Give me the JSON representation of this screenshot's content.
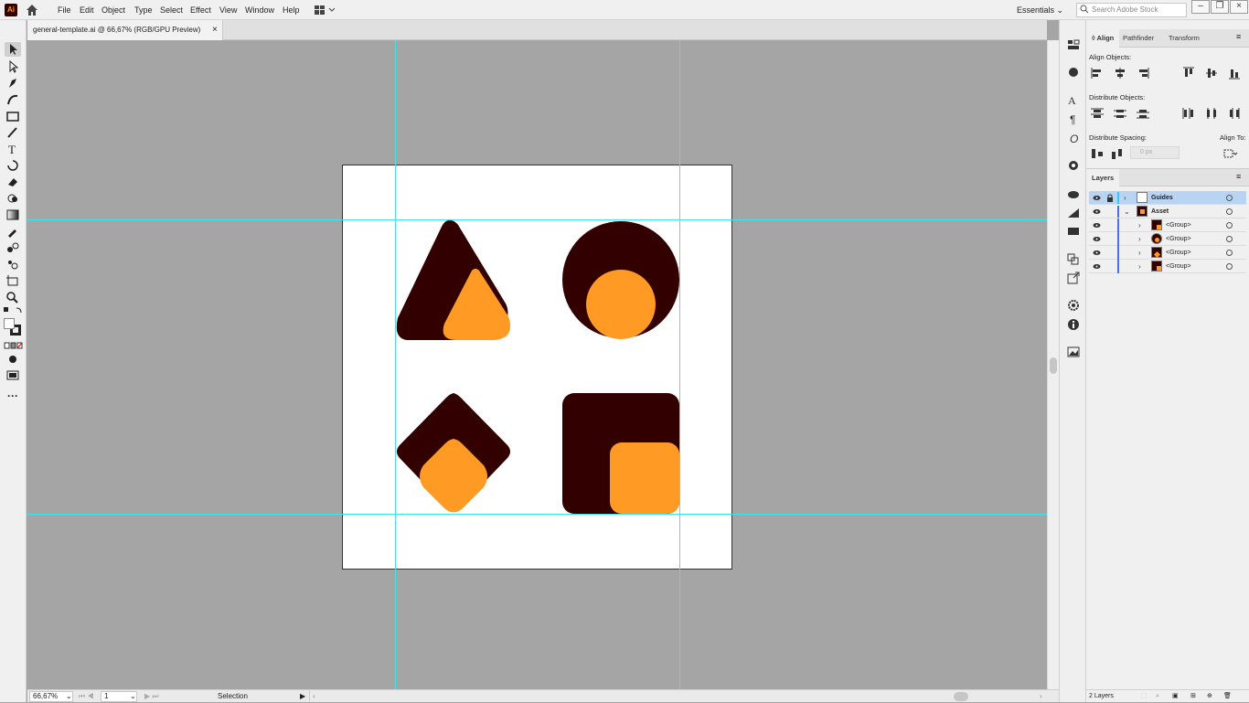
{
  "app": {
    "logo": "Ai",
    "brand_color": "#330000",
    "accent_color": "#ff9a00"
  },
  "menu": [
    "File",
    "Edit",
    "Object",
    "Type",
    "Select",
    "Effect",
    "View",
    "Window",
    "Help"
  ],
  "workspace": {
    "label": "Essentials",
    "search_placeholder": "Search Adobe Stock"
  },
  "document": {
    "tab_title": "general-template.ai @ 66,67% (RGB/GPU Preview)",
    "close": "×"
  },
  "status": {
    "zoom": "66,67%",
    "page": "1",
    "tool": "Selection"
  },
  "align_panel": {
    "tabs": [
      "Align",
      "Pathfinder",
      "Transform"
    ],
    "align_objects_label": "Align Objects:",
    "distribute_objects_label": "Distribute Objects:",
    "distribute_spacing_label": "Distribute Spacing:",
    "align_to_label": "Align To:",
    "spacing_value": "0 px"
  },
  "layers_panel": {
    "tab": "Layers",
    "rows": [
      {
        "name": "Guides",
        "expanded": false,
        "selected": true
      },
      {
        "name": "Asset",
        "expanded": true,
        "selected": false
      },
      {
        "name": "<Group>",
        "expanded": false,
        "selected": false
      },
      {
        "name": "<Group>",
        "expanded": false,
        "selected": false
      },
      {
        "name": "<Group>",
        "expanded": false,
        "selected": false
      },
      {
        "name": "<Group>",
        "expanded": false,
        "selected": false
      }
    ],
    "footer": "2 Layers"
  },
  "colors": {
    "shape_dark": "#330000",
    "shape_orange": "#ff9a24",
    "guide": "#3ce6f0"
  }
}
